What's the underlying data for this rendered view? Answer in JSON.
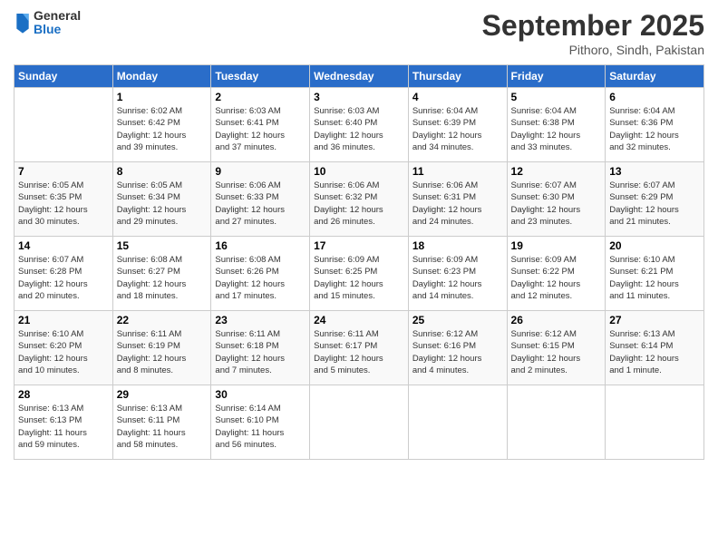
{
  "logo": {
    "general": "General",
    "blue": "Blue"
  },
  "header": {
    "month": "September 2025",
    "location": "Pithoro, Sindh, Pakistan"
  },
  "days_of_week": [
    "Sunday",
    "Monday",
    "Tuesday",
    "Wednesday",
    "Thursday",
    "Friday",
    "Saturday"
  ],
  "weeks": [
    [
      {
        "day": "",
        "info": ""
      },
      {
        "day": "1",
        "info": "Sunrise: 6:02 AM\nSunset: 6:42 PM\nDaylight: 12 hours\nand 39 minutes."
      },
      {
        "day": "2",
        "info": "Sunrise: 6:03 AM\nSunset: 6:41 PM\nDaylight: 12 hours\nand 37 minutes."
      },
      {
        "day": "3",
        "info": "Sunrise: 6:03 AM\nSunset: 6:40 PM\nDaylight: 12 hours\nand 36 minutes."
      },
      {
        "day": "4",
        "info": "Sunrise: 6:04 AM\nSunset: 6:39 PM\nDaylight: 12 hours\nand 34 minutes."
      },
      {
        "day": "5",
        "info": "Sunrise: 6:04 AM\nSunset: 6:38 PM\nDaylight: 12 hours\nand 33 minutes."
      },
      {
        "day": "6",
        "info": "Sunrise: 6:04 AM\nSunset: 6:36 PM\nDaylight: 12 hours\nand 32 minutes."
      }
    ],
    [
      {
        "day": "7",
        "info": "Sunrise: 6:05 AM\nSunset: 6:35 PM\nDaylight: 12 hours\nand 30 minutes."
      },
      {
        "day": "8",
        "info": "Sunrise: 6:05 AM\nSunset: 6:34 PM\nDaylight: 12 hours\nand 29 minutes."
      },
      {
        "day": "9",
        "info": "Sunrise: 6:06 AM\nSunset: 6:33 PM\nDaylight: 12 hours\nand 27 minutes."
      },
      {
        "day": "10",
        "info": "Sunrise: 6:06 AM\nSunset: 6:32 PM\nDaylight: 12 hours\nand 26 minutes."
      },
      {
        "day": "11",
        "info": "Sunrise: 6:06 AM\nSunset: 6:31 PM\nDaylight: 12 hours\nand 24 minutes."
      },
      {
        "day": "12",
        "info": "Sunrise: 6:07 AM\nSunset: 6:30 PM\nDaylight: 12 hours\nand 23 minutes."
      },
      {
        "day": "13",
        "info": "Sunrise: 6:07 AM\nSunset: 6:29 PM\nDaylight: 12 hours\nand 21 minutes."
      }
    ],
    [
      {
        "day": "14",
        "info": "Sunrise: 6:07 AM\nSunset: 6:28 PM\nDaylight: 12 hours\nand 20 minutes."
      },
      {
        "day": "15",
        "info": "Sunrise: 6:08 AM\nSunset: 6:27 PM\nDaylight: 12 hours\nand 18 minutes."
      },
      {
        "day": "16",
        "info": "Sunrise: 6:08 AM\nSunset: 6:26 PM\nDaylight: 12 hours\nand 17 minutes."
      },
      {
        "day": "17",
        "info": "Sunrise: 6:09 AM\nSunset: 6:25 PM\nDaylight: 12 hours\nand 15 minutes."
      },
      {
        "day": "18",
        "info": "Sunrise: 6:09 AM\nSunset: 6:23 PM\nDaylight: 12 hours\nand 14 minutes."
      },
      {
        "day": "19",
        "info": "Sunrise: 6:09 AM\nSunset: 6:22 PM\nDaylight: 12 hours\nand 12 minutes."
      },
      {
        "day": "20",
        "info": "Sunrise: 6:10 AM\nSunset: 6:21 PM\nDaylight: 12 hours\nand 11 minutes."
      }
    ],
    [
      {
        "day": "21",
        "info": "Sunrise: 6:10 AM\nSunset: 6:20 PM\nDaylight: 12 hours\nand 10 minutes."
      },
      {
        "day": "22",
        "info": "Sunrise: 6:11 AM\nSunset: 6:19 PM\nDaylight: 12 hours\nand 8 minutes."
      },
      {
        "day": "23",
        "info": "Sunrise: 6:11 AM\nSunset: 6:18 PM\nDaylight: 12 hours\nand 7 minutes."
      },
      {
        "day": "24",
        "info": "Sunrise: 6:11 AM\nSunset: 6:17 PM\nDaylight: 12 hours\nand 5 minutes."
      },
      {
        "day": "25",
        "info": "Sunrise: 6:12 AM\nSunset: 6:16 PM\nDaylight: 12 hours\nand 4 minutes."
      },
      {
        "day": "26",
        "info": "Sunrise: 6:12 AM\nSunset: 6:15 PM\nDaylight: 12 hours\nand 2 minutes."
      },
      {
        "day": "27",
        "info": "Sunrise: 6:13 AM\nSunset: 6:14 PM\nDaylight: 12 hours\nand 1 minute."
      }
    ],
    [
      {
        "day": "28",
        "info": "Sunrise: 6:13 AM\nSunset: 6:13 PM\nDaylight: 11 hours\nand 59 minutes."
      },
      {
        "day": "29",
        "info": "Sunrise: 6:13 AM\nSunset: 6:11 PM\nDaylight: 11 hours\nand 58 minutes."
      },
      {
        "day": "30",
        "info": "Sunrise: 6:14 AM\nSunset: 6:10 PM\nDaylight: 11 hours\nand 56 minutes."
      },
      {
        "day": "",
        "info": ""
      },
      {
        "day": "",
        "info": ""
      },
      {
        "day": "",
        "info": ""
      },
      {
        "day": "",
        "info": ""
      }
    ]
  ]
}
